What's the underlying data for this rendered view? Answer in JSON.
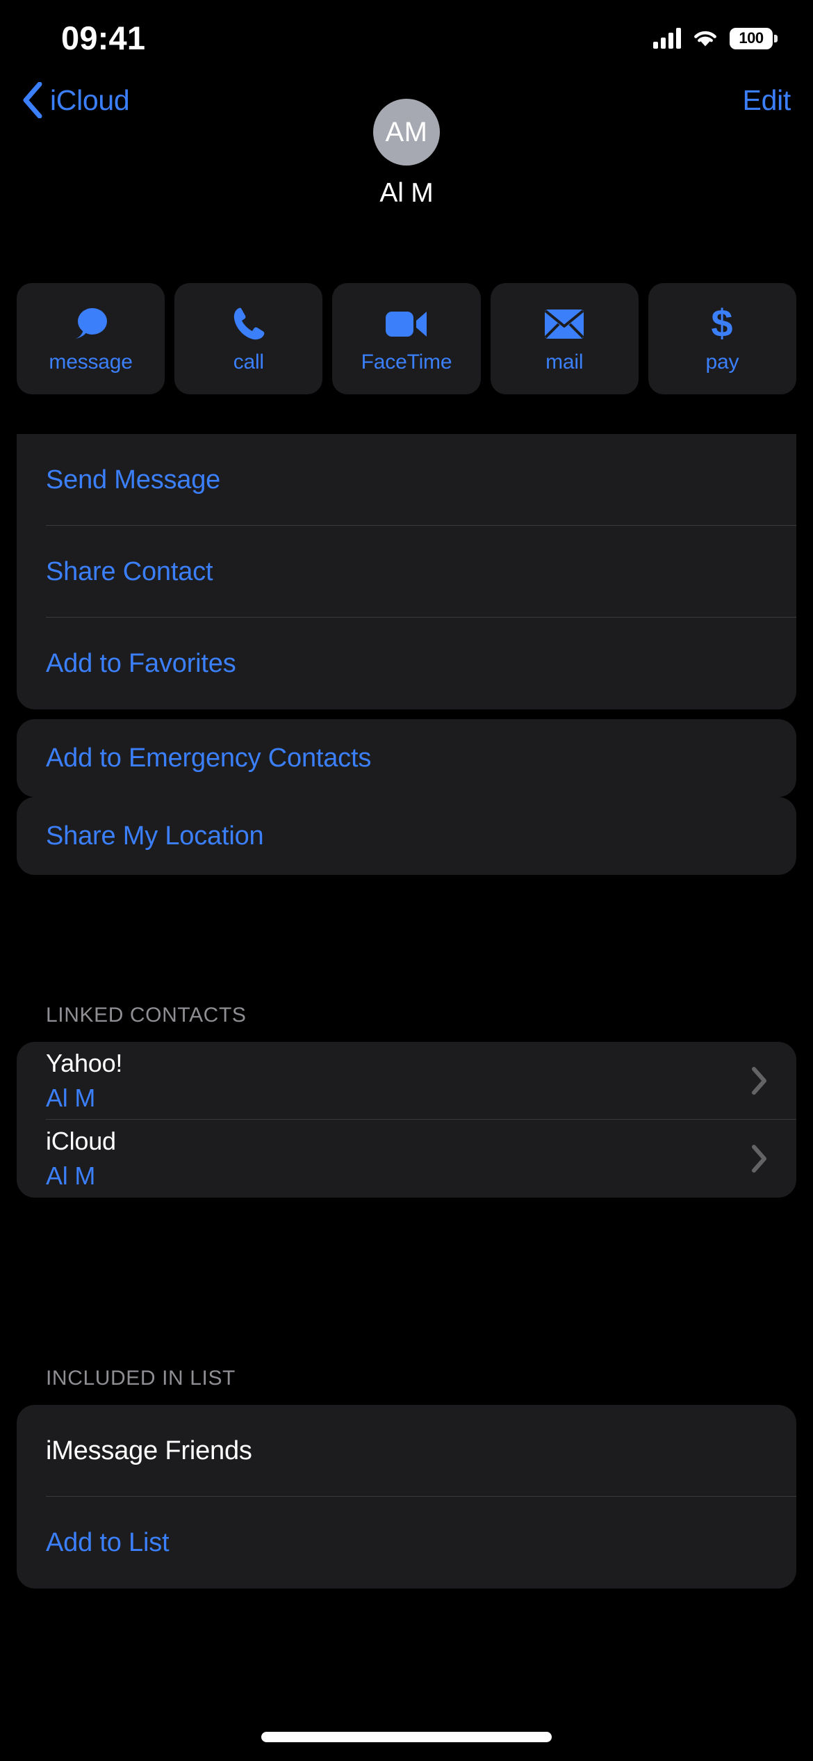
{
  "status_bar": {
    "time": "09:41",
    "battery_level": "100",
    "signal_icon": "cellular-signal-icon",
    "wifi_icon": "wifi-icon",
    "battery_icon": "battery-icon"
  },
  "nav_bar": {
    "back_label": "iCloud",
    "back_icon": "chevron-left-icon",
    "edit_label": "Edit"
  },
  "contact_header": {
    "initials": "AM",
    "name": "Al M",
    "avatar_color": "#a6a9b1"
  },
  "action_tiles": [
    {
      "label": "message",
      "icon": "message-bubble-icon"
    },
    {
      "label": "call",
      "icon": "phone-icon"
    },
    {
      "label": "FaceTime",
      "icon": "video-camera-icon"
    },
    {
      "label": "mail",
      "icon": "envelope-icon"
    },
    {
      "label": "pay",
      "icon": "dollar-sign-icon"
    }
  ],
  "actions_card": {
    "items": [
      {
        "label": "Send Message"
      },
      {
        "label": "Share Contact"
      },
      {
        "label": "Add to Favorites"
      }
    ]
  },
  "emergency_card": {
    "items": [
      {
        "label": "Add to Emergency Contacts"
      }
    ]
  },
  "location_card": {
    "items": [
      {
        "label": "Share My Location"
      }
    ]
  },
  "linked_contacts": {
    "header": "LINKED CONTACTS",
    "rows": [
      {
        "account": "Yahoo!",
        "name": "Al M",
        "accessory": "chevron-right-icon"
      },
      {
        "account": "iCloud",
        "name": "Al M",
        "accessory": "chevron-right-icon"
      }
    ]
  },
  "included_in_list": {
    "header": "INCLUDED IN LIST",
    "list_name": "iMessage Friends",
    "add_label": "Add to List"
  },
  "colors": {
    "accent": "#3b7ffb",
    "card_background": "#1c1c1e",
    "page_background": "#000000",
    "separator": "#3a3a3c",
    "secondary_text": "#8e8e93"
  },
  "home_indicator": "home-indicator"
}
